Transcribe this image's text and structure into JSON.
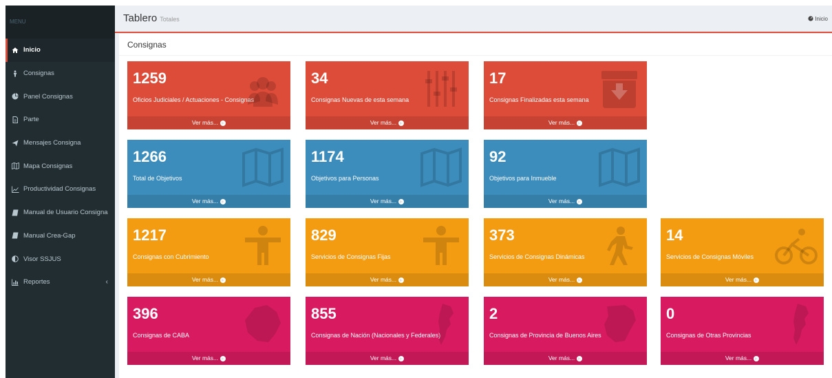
{
  "sidebar": {
    "header": "MENU",
    "items": [
      {
        "label": "Inicio",
        "icon": "home-icon"
      },
      {
        "label": "Consignas",
        "icon": "person-icon"
      },
      {
        "label": "Panel Consignas",
        "icon": "pie-chart-icon"
      },
      {
        "label": "Parte",
        "icon": "document-icon"
      },
      {
        "label": "Mensajes Consigna",
        "icon": "paper-plane-icon"
      },
      {
        "label": "Mapa Consignas",
        "icon": "map-icon"
      },
      {
        "label": "Productividad Consignas",
        "icon": "line-chart-icon"
      },
      {
        "label": "Manual de Usuario Consigna",
        "icon": "book-icon"
      },
      {
        "label": "Manual Crea-Gap",
        "icon": "book-icon"
      },
      {
        "label": "Visor SSJUS",
        "icon": "circle-half-icon"
      },
      {
        "label": "Reportes",
        "icon": "bar-chart-icon"
      }
    ]
  },
  "header": {
    "title": "Tablero",
    "subtitle": "Totales",
    "breadcrumb": "Inicio"
  },
  "panel": {
    "title": "Consignas"
  },
  "colors": {
    "red": "#dd4b39",
    "blue": "#3c8dbc",
    "orange": "#f39c12",
    "pink": "#d81b60",
    "sidebar": "#222d32"
  },
  "boxes": [
    {
      "value": "1259",
      "label": "Oficios Judiciales / Actuaciones - Consignas",
      "footer": "Ver más...",
      "icon": "users-icon",
      "color": "red"
    },
    {
      "value": "34",
      "label": "Consignas Nuevas de esta semana",
      "footer": "Ver más...",
      "icon": "sliders-icon",
      "color": "red"
    },
    {
      "value": "17",
      "label": "Consignas Finalizadas esta semana",
      "footer": "Ver más...",
      "icon": "archive-down-icon",
      "color": "red"
    },
    {
      "value": "1266",
      "label": "Total de Objetivos",
      "footer": "Ver más...",
      "icon": "map-icon",
      "color": "blue"
    },
    {
      "value": "1174",
      "label": "Objetivos para Personas",
      "footer": "Ver más...",
      "icon": "map-icon",
      "color": "blue"
    },
    {
      "value": "92",
      "label": "Objetivos para Inmueble",
      "footer": "Ver más...",
      "icon": "map-icon",
      "color": "blue"
    },
    {
      "value": "1217",
      "label": "Consignas con Cubrimiento",
      "footer": "Ver más...",
      "icon": "person-icon",
      "color": "orange"
    },
    {
      "value": "829",
      "label": "Servicios de Consignas Fijas",
      "footer": "Ver más...",
      "icon": "person-icon",
      "color": "orange"
    },
    {
      "value": "373",
      "label": "Servicios de Consignas Dinámicas",
      "footer": "Ver más...",
      "icon": "walking-icon",
      "color": "orange"
    },
    {
      "value": "14",
      "label": "Servicios de Consignas Móviles",
      "footer": "Ver más...",
      "icon": "bicycle-icon",
      "color": "orange"
    },
    {
      "value": "396",
      "label": "Consignas de CABA",
      "footer": "Ver más...",
      "icon": "caba-map-icon",
      "color": "pink"
    },
    {
      "value": "855",
      "label": "Consignas de Nación (Nacionales y Federales)",
      "footer": "Ver más...",
      "icon": "argentina-map-icon",
      "color": "pink"
    },
    {
      "value": "2",
      "label": "Consignas de Provincia de Buenos Aires",
      "footer": "Ver más...",
      "icon": "province-map-icon",
      "color": "pink"
    },
    {
      "value": "0",
      "label": "Consignas de Otras Provincias",
      "footer": "Ver más...",
      "icon": "argentina-map-icon",
      "color": "pink"
    }
  ]
}
